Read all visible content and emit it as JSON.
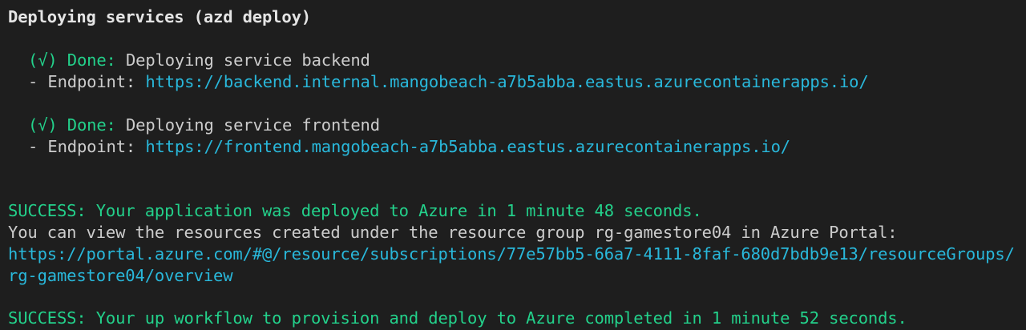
{
  "header": {
    "title": "Deploying services (azd deploy)"
  },
  "services": [
    {
      "status_icon": "(√)",
      "status": "Done:",
      "message": "Deploying service backend",
      "endpoint_label": "- Endpoint:",
      "endpoint_url": "https://backend.internal.mangobeach-a7b5abba.eastus.azurecontainerapps.io/"
    },
    {
      "status_icon": "(√)",
      "status": "Done:",
      "message": "Deploying service frontend",
      "endpoint_label": "- Endpoint:",
      "endpoint_url": "https://frontend.mangobeach-a7b5abba.eastus.azurecontainerapps.io/"
    }
  ],
  "deploy_result": {
    "success": "SUCCESS: Your application was deployed to Azure in 1 minute 48 seconds.",
    "info": "You can view the resources created under the resource group rg-gamestore04 in Azure Portal:",
    "portal_url_line1": "https://portal.azure.com/#@/resource/subscriptions/77e57bb5-66a7-4111-8faf-680d7bdb9e13/resourceGroups/",
    "portal_url_line2": "rg-gamestore04/overview"
  },
  "up_result": {
    "success": "SUCCESS: Your up workflow to provision and deploy to Azure completed in 1 minute 52 seconds."
  },
  "colors": {
    "background": "#1e1e1e",
    "text": "#cccccc",
    "success": "#23d18b",
    "link": "#29b8db"
  }
}
